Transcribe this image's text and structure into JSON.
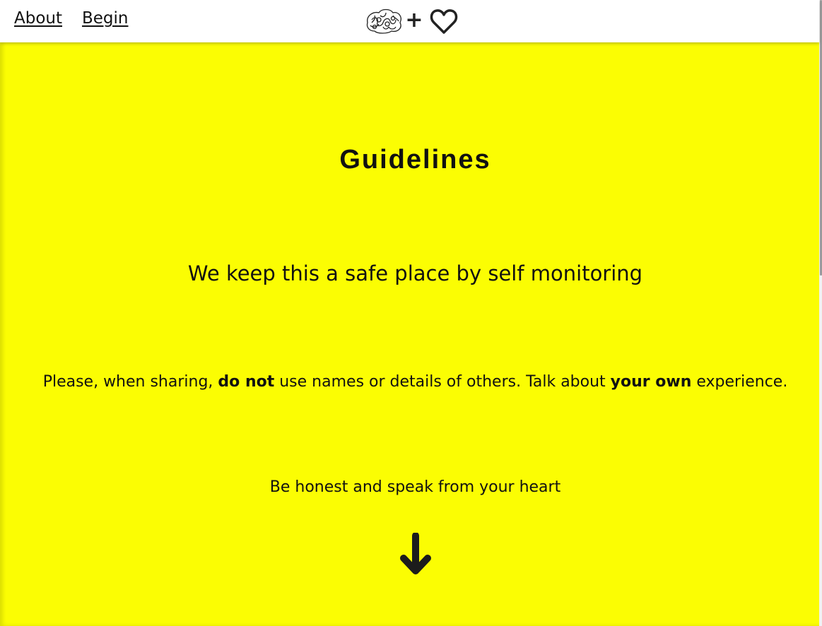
{
  "nav": {
    "about_label": "About",
    "begin_label": "Begin",
    "logo": {
      "brain_icon": "brain-icon",
      "plus_symbol": "+",
      "heart_icon": "heart-outline-icon"
    }
  },
  "main": {
    "heading": "Guidelines",
    "line1": "We keep this a safe place by self monitoring",
    "line2": {
      "part1": "Please, when sharing, ",
      "bold1": "do not",
      "part2": " use names or details of others. Talk about ",
      "bold2": "your own",
      "part3": " experience."
    },
    "line3": "Be honest and speak from your heart",
    "arrow_icon": "arrow-down-icon"
  },
  "colors": {
    "background": "#fbfd03",
    "text": "#111111",
    "navbar": "#ffffff"
  }
}
